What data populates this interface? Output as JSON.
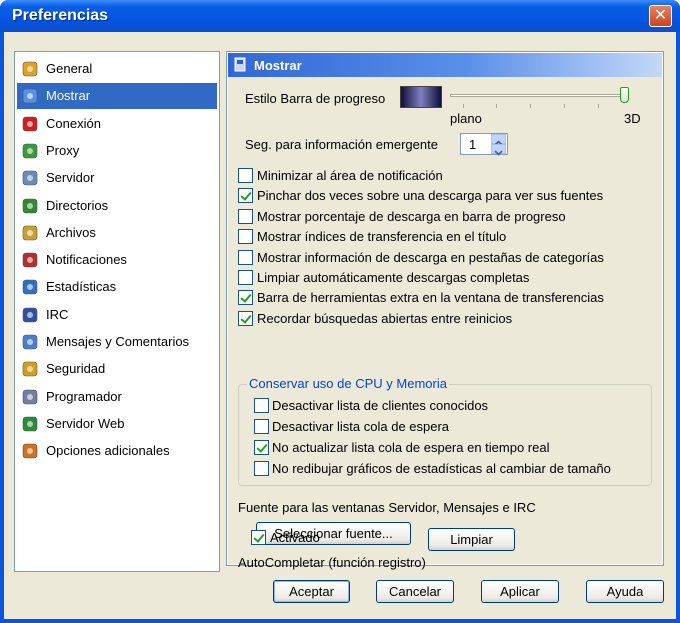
{
  "window": {
    "title": "Preferencias",
    "close_glyph": "✕"
  },
  "sidebar": {
    "items": [
      {
        "label": "General",
        "icon": "gears-icon",
        "color": "#e0a020"
      },
      {
        "label": "Mostrar",
        "icon": "display-icon",
        "color": "#5a8fe8"
      },
      {
        "label": "Conexión",
        "icon": "plug-icon",
        "color": "#cc2020"
      },
      {
        "label": "Proxy",
        "icon": "proxy-icon",
        "color": "#3a9a3a"
      },
      {
        "label": "Servidor",
        "icon": "server-icon",
        "color": "#6a8ab8"
      },
      {
        "label": "Directorios",
        "icon": "folder-icon",
        "color": "#2f8a2f"
      },
      {
        "label": "Archivos",
        "icon": "files-icon",
        "color": "#c8a030"
      },
      {
        "label": "Notificaciones",
        "icon": "notification-icon",
        "color": "#b03030"
      },
      {
        "label": "Estadísticas",
        "icon": "statistics-icon",
        "color": "#3070c0"
      },
      {
        "label": "IRC",
        "icon": "irc-icon",
        "color": "#3050a0"
      },
      {
        "label": "Mensajes y Comentarios",
        "icon": "messages-icon",
        "color": "#4a80c8"
      },
      {
        "label": "Seguridad",
        "icon": "lock-icon",
        "color": "#d0a020"
      },
      {
        "label": "Programador",
        "icon": "calendar-icon",
        "color": "#7080a0"
      },
      {
        "label": "Servidor Web",
        "icon": "globe-icon",
        "color": "#2a8a3a"
      },
      {
        "label": "Opciones adicionales",
        "icon": "options-icon",
        "color": "#d07020"
      }
    ],
    "selected_index": 1
  },
  "panel": {
    "title": "Mostrar",
    "progress_style_label": "Estilo Barra de progreso",
    "slider_min_label": "plano",
    "slider_max_label": "3D",
    "slider_level": 1.0,
    "popup_label": "Seg. para información emergente",
    "popup_value": "1",
    "options": [
      {
        "label": "Minimizar al área de notificación",
        "checked": false
      },
      {
        "label": "Pinchar dos veces sobre una descarga para ver sus fuentes",
        "checked": true
      },
      {
        "label": "Mostrar porcentaje de descarga en barra de progreso",
        "checked": false
      },
      {
        "label": "Mostrar índices de transferencia en el título",
        "checked": false
      },
      {
        "label": "Mostrar información de descarga en pestañas de categorías",
        "checked": false
      },
      {
        "label": "Limpiar automáticamente descargas completas",
        "checked": false
      },
      {
        "label": "Barra de herramientas extra en la ventana de transferencias",
        "checked": true
      },
      {
        "label": "Recordar búsquedas abiertas entre reinicios",
        "checked": true
      }
    ],
    "cpu_group": {
      "label": "Conservar uso de CPU y Memoria",
      "options": [
        {
          "label": "Desactivar lista de clientes conocidos",
          "checked": false
        },
        {
          "label": "Desactivar lista cola de espera",
          "checked": false
        },
        {
          "label": "No actualizar lista cola de espera en tiempo real",
          "checked": true
        },
        {
          "label": "No redibujar gráficos de estadísticas al cambiar de tamaño",
          "checked": false
        }
      ]
    },
    "font_label": "Fuente para las ventanas Servidor, Mensajes e IRC",
    "font_button": "Seleccionar fuente...",
    "autocomplete_label": "AutoCompletar (función registro)",
    "autocomplete_option": {
      "label": "Activado",
      "checked": true
    },
    "clear_button": "Limpiar"
  },
  "footer": {
    "accept": "Aceptar",
    "cancel": "Cancelar",
    "apply": "Aplicar",
    "help": "Ayuda"
  }
}
